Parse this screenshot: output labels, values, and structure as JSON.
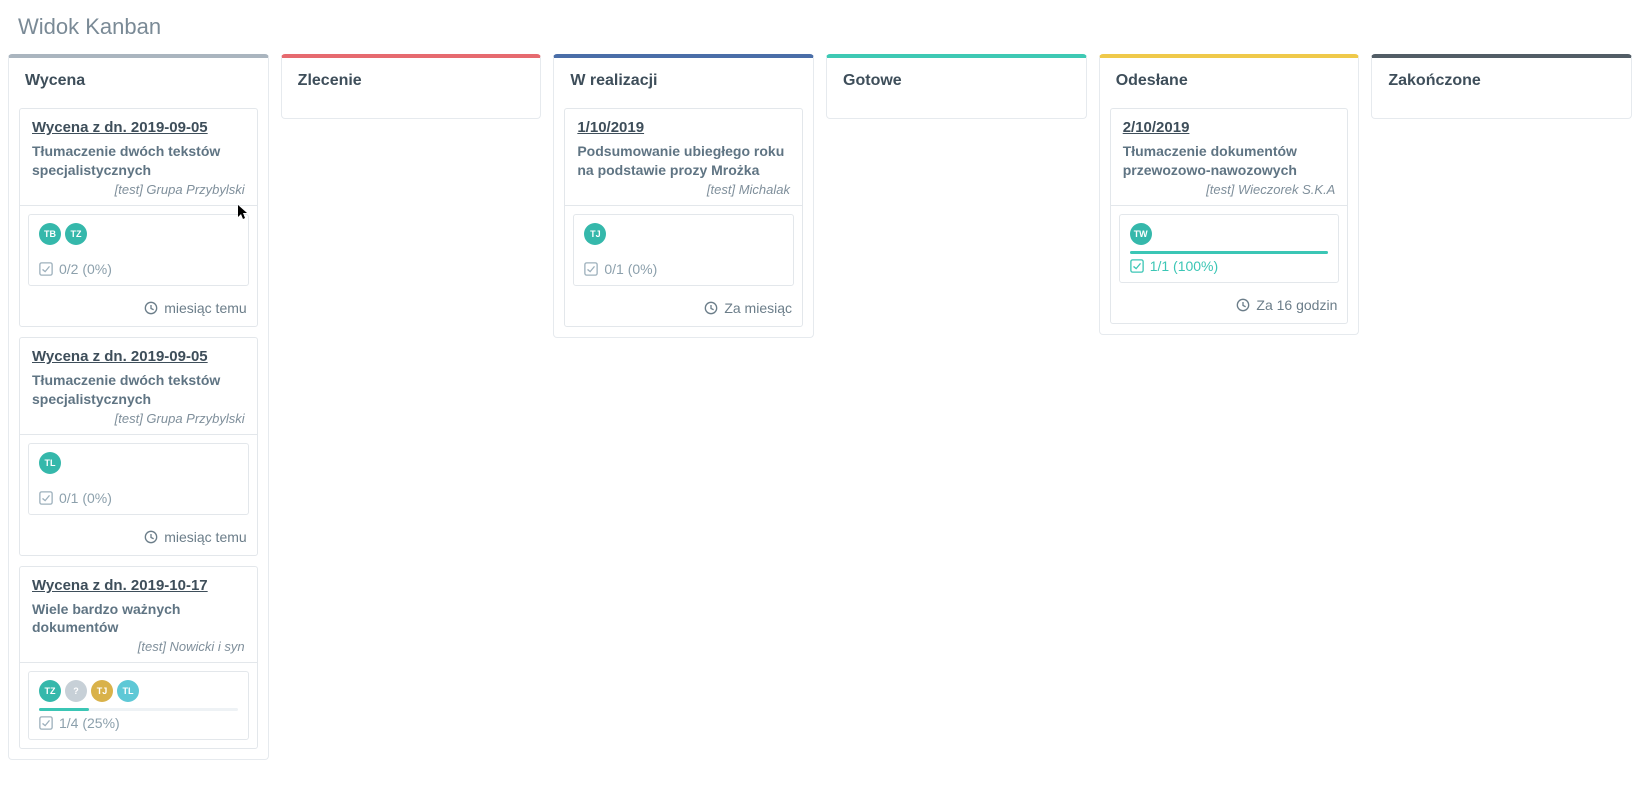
{
  "page_title": "Widok Kanban",
  "colors": {
    "grey": "#aab5bf",
    "red": "#e66a6f",
    "blue": "#4a6ea8",
    "teal": "#3ec9b4",
    "yellow": "#efc94a",
    "dark": "#525d66"
  },
  "avatar_colors": {
    "teal": "#35b8ab",
    "blue": "#5db3d8",
    "grey": "#c7d0d7",
    "gold": "#d9b24a",
    "cyan": "#5ec8d6"
  },
  "columns": [
    {
      "title": "Wycena",
      "color_key": "grey",
      "cards": [
        {
          "title": "Wycena z dn. 2019-09-05",
          "desc": "Tłumaczenie dwóch tekstów specjalistycznych",
          "client": "[test] Grupa Przybylski",
          "avatars": [
            {
              "label": "TB",
              "ck": "teal"
            },
            {
              "label": "TZ",
              "ck": "teal"
            }
          ],
          "progress_text": "0/2 (0%)",
          "progress_pct": 0,
          "progress_done": false,
          "time_text": "miesiąc temu"
        },
        {
          "title": "Wycena z dn. 2019-09-05",
          "desc": "Tłumaczenie dwóch tekstów specjalistycznych",
          "client": "[test] Grupa Przybylski",
          "avatars": [
            {
              "label": "TL",
              "ck": "teal"
            }
          ],
          "progress_text": "0/1 (0%)",
          "progress_pct": 0,
          "progress_done": false,
          "time_text": "miesiąc temu"
        },
        {
          "title": "Wycena z dn. 2019-10-17",
          "desc": "Wiele bardzo ważnych dokumentów",
          "client": "[test] Nowicki i syn",
          "avatars": [
            {
              "label": "TZ",
              "ck": "teal"
            },
            {
              "label": "?",
              "ck": "grey"
            },
            {
              "label": "TJ",
              "ck": "gold"
            },
            {
              "label": "TL",
              "ck": "cyan"
            }
          ],
          "progress_text": "1/4 (25%)",
          "progress_pct": 25,
          "progress_done": false,
          "time_text": ""
        }
      ]
    },
    {
      "title": "Zlecenie",
      "color_key": "red",
      "cards": []
    },
    {
      "title": "W realizacji",
      "color_key": "blue",
      "cards": [
        {
          "title": "1/10/2019",
          "desc": "Podsumowanie ubiegłego roku na podstawie prozy Mrożka",
          "client": "[test] Michalak",
          "avatars": [
            {
              "label": "TJ",
              "ck": "teal"
            }
          ],
          "progress_text": "0/1 (0%)",
          "progress_pct": 0,
          "progress_done": false,
          "time_text": "Za miesiąc"
        }
      ]
    },
    {
      "title": "Gotowe",
      "color_key": "teal",
      "cards": []
    },
    {
      "title": "Odesłane",
      "color_key": "yellow",
      "cards": [
        {
          "title": "2/10/2019",
          "desc": "Tłumaczenie dokumentów przewozowo-nawozowych",
          "client": "[test] Wieczorek S.K.A",
          "avatars": [
            {
              "label": "TW",
              "ck": "teal"
            }
          ],
          "progress_text": "1/1 (100%)",
          "progress_pct": 100,
          "progress_done": true,
          "time_text": "Za 16 godzin"
        }
      ]
    },
    {
      "title": "Zakończone",
      "color_key": "dark",
      "cards": []
    }
  ]
}
